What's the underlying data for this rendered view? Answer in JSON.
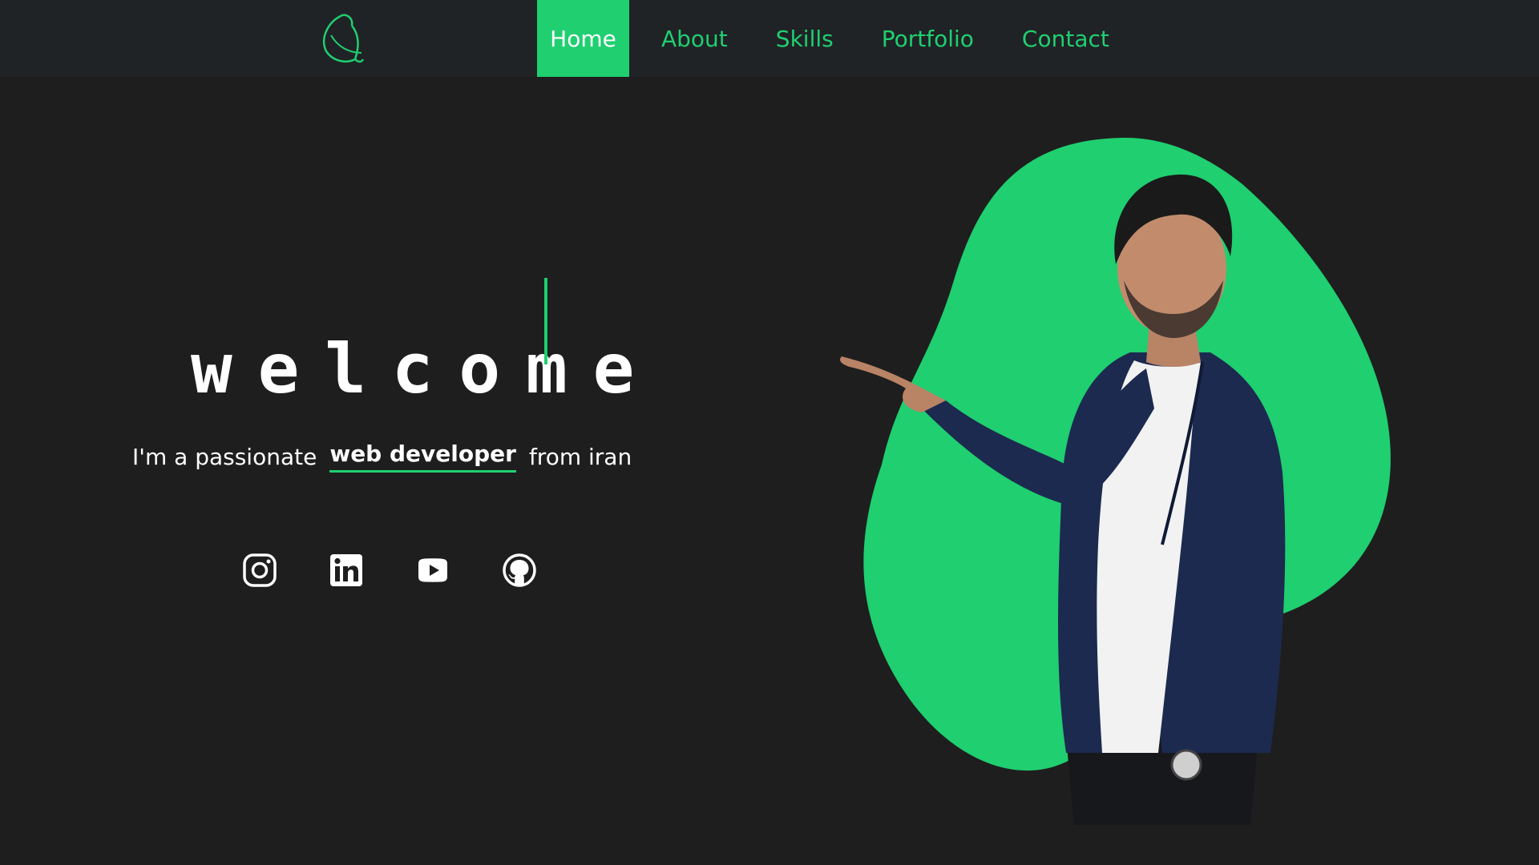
{
  "nav": {
    "items": [
      {
        "label": "Home",
        "active": true
      },
      {
        "label": "About",
        "active": false
      },
      {
        "label": "Skills",
        "active": false
      },
      {
        "label": "Portfolio",
        "active": false
      },
      {
        "label": "Contact",
        "active": false
      }
    ]
  },
  "hero": {
    "heading": "welcome",
    "tagline": {
      "prefix": "I'm a passionate",
      "highlight": "web developer",
      "suffix": "from iran"
    },
    "socials": [
      {
        "icon": "instagram-icon"
      },
      {
        "icon": "linkedin-icon"
      },
      {
        "icon": "youtube-icon"
      },
      {
        "icon": "github-icon"
      }
    ]
  },
  "colors": {
    "accent": "#1fcf70",
    "background": "#1e1e1e",
    "navbar": "#202326",
    "text": "#ffffff"
  }
}
